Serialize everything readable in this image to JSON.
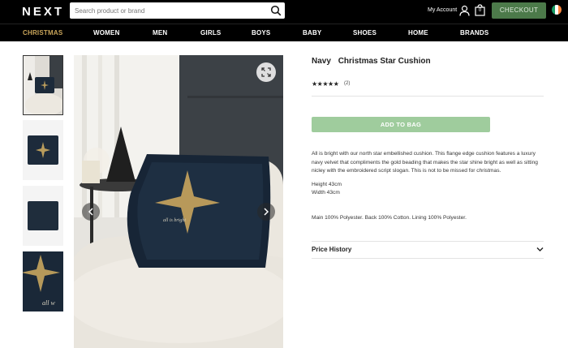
{
  "header": {
    "logo": "NEXT",
    "search_placeholder": "Search product or brand",
    "account_label": "My Account",
    "bag_count": "0",
    "checkout_label": "CHECKOUT",
    "checkout_color": "#4c7a4a"
  },
  "nav": {
    "items": [
      {
        "label": "CHRISTMAS",
        "active": true
      },
      {
        "label": "WOMEN"
      },
      {
        "label": "MEN"
      },
      {
        "label": "GIRLS"
      },
      {
        "label": "BOYS"
      },
      {
        "label": "BABY"
      },
      {
        "label": "SHOES"
      },
      {
        "label": "HOME"
      },
      {
        "label": "BRANDS"
      }
    ],
    "active_color": "#c9a55a"
  },
  "product": {
    "color_name": "Navy",
    "name": "Christmas Star Cushion",
    "rating": 5,
    "stars_text": "★★★★★",
    "review_count": "(2)",
    "add_to_bag_label": "ADD TO BAG",
    "description": "All is bright with our north star embellished cushion. This flange edge cushion features a luxury navy velvet that compliments the gold beading that makes the star shine bright as well as sitting nicley with the embroidered script slogan. This is not to be missed for christmas.",
    "height": "Height 43cm",
    "width": "Width 43cm",
    "composition": "Main 100% Polyester. Back 100% Cotton. Lining 100% Polyester.",
    "price_history_label": "Price History"
  },
  "icons": {
    "search": "search-icon",
    "account": "account-icon",
    "bag": "bag-icon",
    "expand": "expand-icon",
    "prev": "chevron-left-icon",
    "next": "chevron-right-icon",
    "price_history": "chevron-down-icon"
  }
}
